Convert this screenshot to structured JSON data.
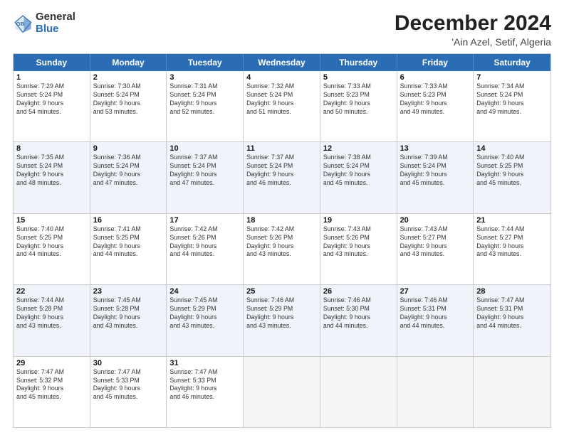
{
  "logo": {
    "general": "General",
    "blue": "Blue"
  },
  "header": {
    "month": "December 2024",
    "location": "'Ain Azel, Setif, Algeria"
  },
  "weekdays": [
    "Sunday",
    "Monday",
    "Tuesday",
    "Wednesday",
    "Thursday",
    "Friday",
    "Saturday"
  ],
  "weeks": [
    [
      {
        "day": "1",
        "lines": [
          "Sunrise: 7:29 AM",
          "Sunset: 5:24 PM",
          "Daylight: 9 hours",
          "and 54 minutes."
        ]
      },
      {
        "day": "2",
        "lines": [
          "Sunrise: 7:30 AM",
          "Sunset: 5:24 PM",
          "Daylight: 9 hours",
          "and 53 minutes."
        ]
      },
      {
        "day": "3",
        "lines": [
          "Sunrise: 7:31 AM",
          "Sunset: 5:24 PM",
          "Daylight: 9 hours",
          "and 52 minutes."
        ]
      },
      {
        "day": "4",
        "lines": [
          "Sunrise: 7:32 AM",
          "Sunset: 5:24 PM",
          "Daylight: 9 hours",
          "and 51 minutes."
        ]
      },
      {
        "day": "5",
        "lines": [
          "Sunrise: 7:33 AM",
          "Sunset: 5:23 PM",
          "Daylight: 9 hours",
          "and 50 minutes."
        ]
      },
      {
        "day": "6",
        "lines": [
          "Sunrise: 7:33 AM",
          "Sunset: 5:23 PM",
          "Daylight: 9 hours",
          "and 49 minutes."
        ]
      },
      {
        "day": "7",
        "lines": [
          "Sunrise: 7:34 AM",
          "Sunset: 5:24 PM",
          "Daylight: 9 hours",
          "and 49 minutes."
        ]
      }
    ],
    [
      {
        "day": "8",
        "lines": [
          "Sunrise: 7:35 AM",
          "Sunset: 5:24 PM",
          "Daylight: 9 hours",
          "and 48 minutes."
        ]
      },
      {
        "day": "9",
        "lines": [
          "Sunrise: 7:36 AM",
          "Sunset: 5:24 PM",
          "Daylight: 9 hours",
          "and 47 minutes."
        ]
      },
      {
        "day": "10",
        "lines": [
          "Sunrise: 7:37 AM",
          "Sunset: 5:24 PM",
          "Daylight: 9 hours",
          "and 47 minutes."
        ]
      },
      {
        "day": "11",
        "lines": [
          "Sunrise: 7:37 AM",
          "Sunset: 5:24 PM",
          "Daylight: 9 hours",
          "and 46 minutes."
        ]
      },
      {
        "day": "12",
        "lines": [
          "Sunrise: 7:38 AM",
          "Sunset: 5:24 PM",
          "Daylight: 9 hours",
          "and 45 minutes."
        ]
      },
      {
        "day": "13",
        "lines": [
          "Sunrise: 7:39 AM",
          "Sunset: 5:24 PM",
          "Daylight: 9 hours",
          "and 45 minutes."
        ]
      },
      {
        "day": "14",
        "lines": [
          "Sunrise: 7:40 AM",
          "Sunset: 5:25 PM",
          "Daylight: 9 hours",
          "and 45 minutes."
        ]
      }
    ],
    [
      {
        "day": "15",
        "lines": [
          "Sunrise: 7:40 AM",
          "Sunset: 5:25 PM",
          "Daylight: 9 hours",
          "and 44 minutes."
        ]
      },
      {
        "day": "16",
        "lines": [
          "Sunrise: 7:41 AM",
          "Sunset: 5:25 PM",
          "Daylight: 9 hours",
          "and 44 minutes."
        ]
      },
      {
        "day": "17",
        "lines": [
          "Sunrise: 7:42 AM",
          "Sunset: 5:26 PM",
          "Daylight: 9 hours",
          "and 44 minutes."
        ]
      },
      {
        "day": "18",
        "lines": [
          "Sunrise: 7:42 AM",
          "Sunset: 5:26 PM",
          "Daylight: 9 hours",
          "and 43 minutes."
        ]
      },
      {
        "day": "19",
        "lines": [
          "Sunrise: 7:43 AM",
          "Sunset: 5:26 PM",
          "Daylight: 9 hours",
          "and 43 minutes."
        ]
      },
      {
        "day": "20",
        "lines": [
          "Sunrise: 7:43 AM",
          "Sunset: 5:27 PM",
          "Daylight: 9 hours",
          "and 43 minutes."
        ]
      },
      {
        "day": "21",
        "lines": [
          "Sunrise: 7:44 AM",
          "Sunset: 5:27 PM",
          "Daylight: 9 hours",
          "and 43 minutes."
        ]
      }
    ],
    [
      {
        "day": "22",
        "lines": [
          "Sunrise: 7:44 AM",
          "Sunset: 5:28 PM",
          "Daylight: 9 hours",
          "and 43 minutes."
        ]
      },
      {
        "day": "23",
        "lines": [
          "Sunrise: 7:45 AM",
          "Sunset: 5:28 PM",
          "Daylight: 9 hours",
          "and 43 minutes."
        ]
      },
      {
        "day": "24",
        "lines": [
          "Sunrise: 7:45 AM",
          "Sunset: 5:29 PM",
          "Daylight: 9 hours",
          "and 43 minutes."
        ]
      },
      {
        "day": "25",
        "lines": [
          "Sunrise: 7:46 AM",
          "Sunset: 5:29 PM",
          "Daylight: 9 hours",
          "and 43 minutes."
        ]
      },
      {
        "day": "26",
        "lines": [
          "Sunrise: 7:46 AM",
          "Sunset: 5:30 PM",
          "Daylight: 9 hours",
          "and 44 minutes."
        ]
      },
      {
        "day": "27",
        "lines": [
          "Sunrise: 7:46 AM",
          "Sunset: 5:31 PM",
          "Daylight: 9 hours",
          "and 44 minutes."
        ]
      },
      {
        "day": "28",
        "lines": [
          "Sunrise: 7:47 AM",
          "Sunset: 5:31 PM",
          "Daylight: 9 hours",
          "and 44 minutes."
        ]
      }
    ],
    [
      {
        "day": "29",
        "lines": [
          "Sunrise: 7:47 AM",
          "Sunset: 5:32 PM",
          "Daylight: 9 hours",
          "and 45 minutes."
        ]
      },
      {
        "day": "30",
        "lines": [
          "Sunrise: 7:47 AM",
          "Sunset: 5:33 PM",
          "Daylight: 9 hours",
          "and 45 minutes."
        ]
      },
      {
        "day": "31",
        "lines": [
          "Sunrise: 7:47 AM",
          "Sunset: 5:33 PM",
          "Daylight: 9 hours",
          "and 46 minutes."
        ]
      },
      {
        "day": "",
        "lines": []
      },
      {
        "day": "",
        "lines": []
      },
      {
        "day": "",
        "lines": []
      },
      {
        "day": "",
        "lines": []
      }
    ]
  ],
  "alt_rows": [
    1,
    3
  ]
}
